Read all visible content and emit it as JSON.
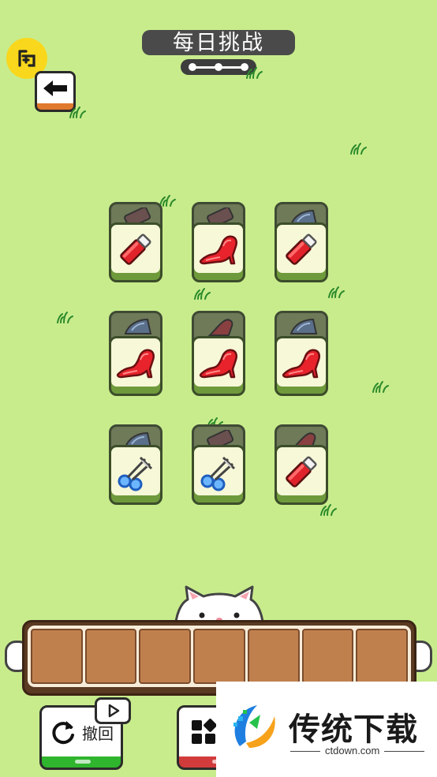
{
  "header": {
    "title": "每日挑战",
    "app_logo_icon": "app-logo-icon",
    "back_icon": "arrow-left-icon"
  },
  "progress": {
    "steps": 3
  },
  "board": {
    "tiles": [
      {
        "row": 1,
        "col": 1,
        "item": "red-tube",
        "under": "knife"
      },
      {
        "row": 1,
        "col": 2,
        "item": "red-high-heel",
        "under": "knife"
      },
      {
        "row": 1,
        "col": 3,
        "item": "red-tube",
        "under": "iron"
      },
      {
        "row": 2,
        "col": 1,
        "item": "red-high-heel",
        "under": "iron"
      },
      {
        "row": 2,
        "col": 2,
        "item": "red-high-heel",
        "under": "red-high-heel"
      },
      {
        "row": 2,
        "col": 3,
        "item": "red-high-heel",
        "under": "iron"
      },
      {
        "row": 3,
        "col": 1,
        "item": "blue-scissors",
        "under": "iron"
      },
      {
        "row": 3,
        "col": 2,
        "item": "blue-scissors",
        "under": "knife"
      },
      {
        "row": 3,
        "col": 3,
        "item": "red-tube",
        "under": "red-high-heel"
      }
    ]
  },
  "tray": {
    "slots": 7,
    "filled": 0
  },
  "buttons": {
    "undo_label": "撤回",
    "undo_icon": "rotate-icon",
    "shuffle_icon": "grid-icon",
    "video_icon": "video-play-icon"
  },
  "watermark": {
    "title": "传统下载",
    "url": "ctdown.com"
  },
  "colors": {
    "background": "#c8ec8c",
    "tile_face": "#f6f8d8",
    "tile_base": "#6f9a3c",
    "tray_slot": "#c0804e",
    "undo_accent": "#2fb52e",
    "shuffle_accent": "#d23b3b",
    "title_bg": "#4a4a4a"
  }
}
